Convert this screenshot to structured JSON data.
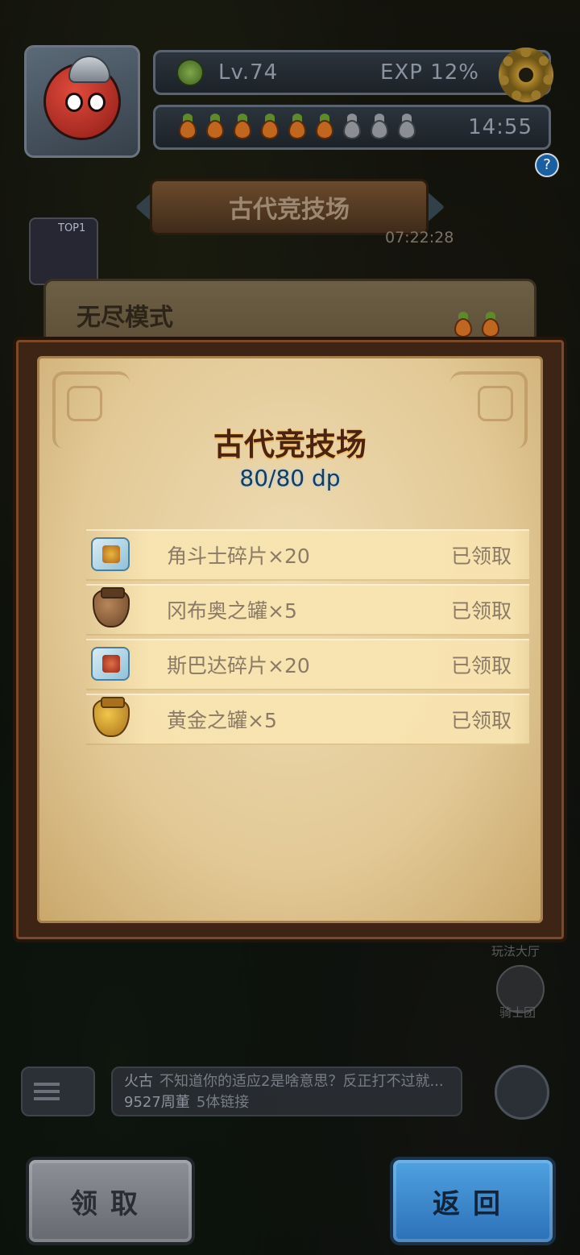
{
  "hud": {
    "level": "Lv.74",
    "exp": "EXP  12%",
    "stamina_full": 6,
    "stamina_total": 9,
    "stamina_timer": "14:55"
  },
  "banner": {
    "title": "古代竞技场",
    "countdown": "07:22:28"
  },
  "badges": {
    "top": "TOP1",
    "help": "?"
  },
  "background_card": {
    "title": "无尽模式"
  },
  "dialog": {
    "title": "古代竞技场",
    "dp": "80/80 dp",
    "rewards": [
      {
        "icon": "gladiator-shard-icon",
        "name": "角斗士碎片×20",
        "status": "已领取"
      },
      {
        "icon": "bronze-jar-icon",
        "name": "冈布奥之罐×5",
        "status": "已领取"
      },
      {
        "icon": "spartan-shard-icon",
        "name": "斯巴达碎片×20",
        "status": "已领取"
      },
      {
        "icon": "golden-jar-icon",
        "name": "黄金之罐×5",
        "status": "已领取"
      }
    ]
  },
  "side": {
    "play_label": "玩法大厅",
    "knight_label": "骑士团"
  },
  "chat": {
    "line1_name": "火古",
    "line1_text": "不知道你的适应2是啥意思？反正打不过就...",
    "line2_name": "9527周董",
    "line2_text": "5体链接"
  },
  "buttons": {
    "claim": "领取",
    "back": "返回"
  },
  "colors": {
    "parchment": "#e8d2a4",
    "title_brown": "#4a2410",
    "dp_blue": "#1a3a5a",
    "back_button": "#3b8ad0",
    "claim_button": "#7a7e84"
  }
}
